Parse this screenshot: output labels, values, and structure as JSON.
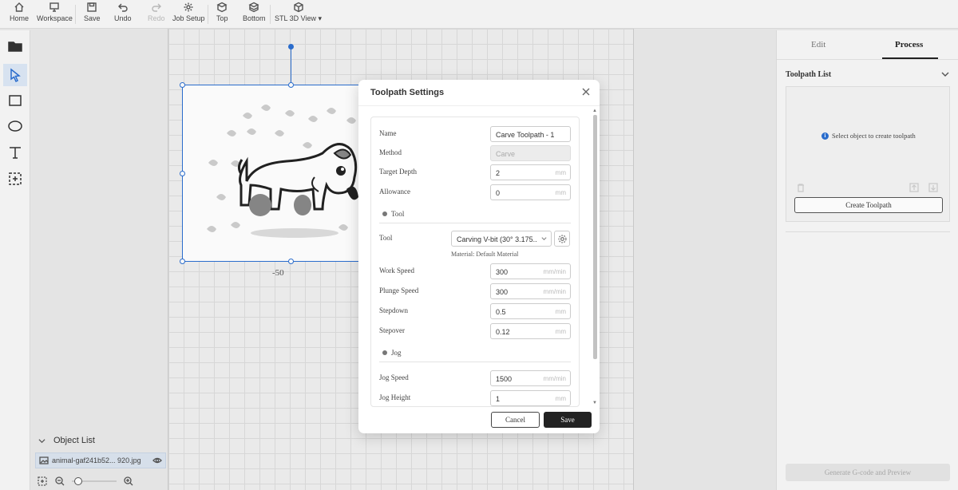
{
  "toolbar": {
    "items": [
      {
        "label": "Home",
        "icon": "home-icon",
        "enabled": true
      },
      {
        "label": "Workspace",
        "icon": "workspace-icon",
        "enabled": true
      },
      {
        "label": "Save",
        "icon": "save-icon",
        "enabled": true
      },
      {
        "label": "Undo",
        "icon": "undo-icon",
        "enabled": true
      },
      {
        "label": "Redo",
        "icon": "redo-icon",
        "enabled": false
      },
      {
        "label": "Job Setup",
        "icon": "gear-icon",
        "enabled": true
      },
      {
        "label": "Top",
        "icon": "top-view-icon",
        "enabled": true
      },
      {
        "label": "Bottom",
        "icon": "bottom-view-icon",
        "enabled": true
      },
      {
        "label": "STL 3D View ▾",
        "icon": "cube-icon",
        "enabled": true
      }
    ]
  },
  "left_tools": [
    "open-folder-icon",
    "select-arrow-icon",
    "rectangle-icon",
    "ellipse-icon",
    "text-icon",
    "add-frame-icon"
  ],
  "object_list": {
    "title": "Object List",
    "items": [
      {
        "name": "animal-gaf241b52... 920.jpg"
      }
    ],
    "zoom": 0.15
  },
  "canvas": {
    "coord_label": "-50"
  },
  "right_panel": {
    "tabs": [
      "Edit",
      "Process"
    ],
    "active_tab": "Process",
    "toolpath_list_title": "Toolpath List",
    "empty_message": "Select object to create toolpath",
    "create_button": "Create Toolpath",
    "generate_button": "Generate G-code and Preview"
  },
  "dialog": {
    "title": "Toolpath Settings",
    "fields": {
      "name": {
        "label": "Name",
        "value": "Carve Toolpath - 1"
      },
      "method": {
        "label": "Method",
        "value": "Carve"
      },
      "target_depth": {
        "label": "Target Depth",
        "value": "2",
        "unit": "mm"
      },
      "allowance": {
        "label": "Allowance",
        "value": "0",
        "unit": "mm"
      },
      "tool": {
        "label": "Tool",
        "value": "Carving V-bit (30° 3.175..."
      },
      "material": "Material: Default Material",
      "work_speed": {
        "label": "Work Speed",
        "value": "300",
        "unit": "mm/min"
      },
      "plunge_speed": {
        "label": "Plunge Speed",
        "value": "300",
        "unit": "mm/min"
      },
      "stepdown": {
        "label": "Stepdown",
        "value": "0.5",
        "unit": "mm"
      },
      "stepover": {
        "label": "Stepover",
        "value": "0.12",
        "unit": "mm"
      },
      "jog_speed": {
        "label": "Jog Speed",
        "value": "1500",
        "unit": "mm/min"
      },
      "jog_height": {
        "label": "Jog Height",
        "value": "1",
        "unit": "mm"
      }
    },
    "sections": {
      "tool": "Tool",
      "jog": "Jog"
    },
    "cancel_label": "Cancel",
    "save_label": "Save"
  },
  "colors": {
    "accent": "#2b6fd1",
    "save_button": "#222222"
  }
}
